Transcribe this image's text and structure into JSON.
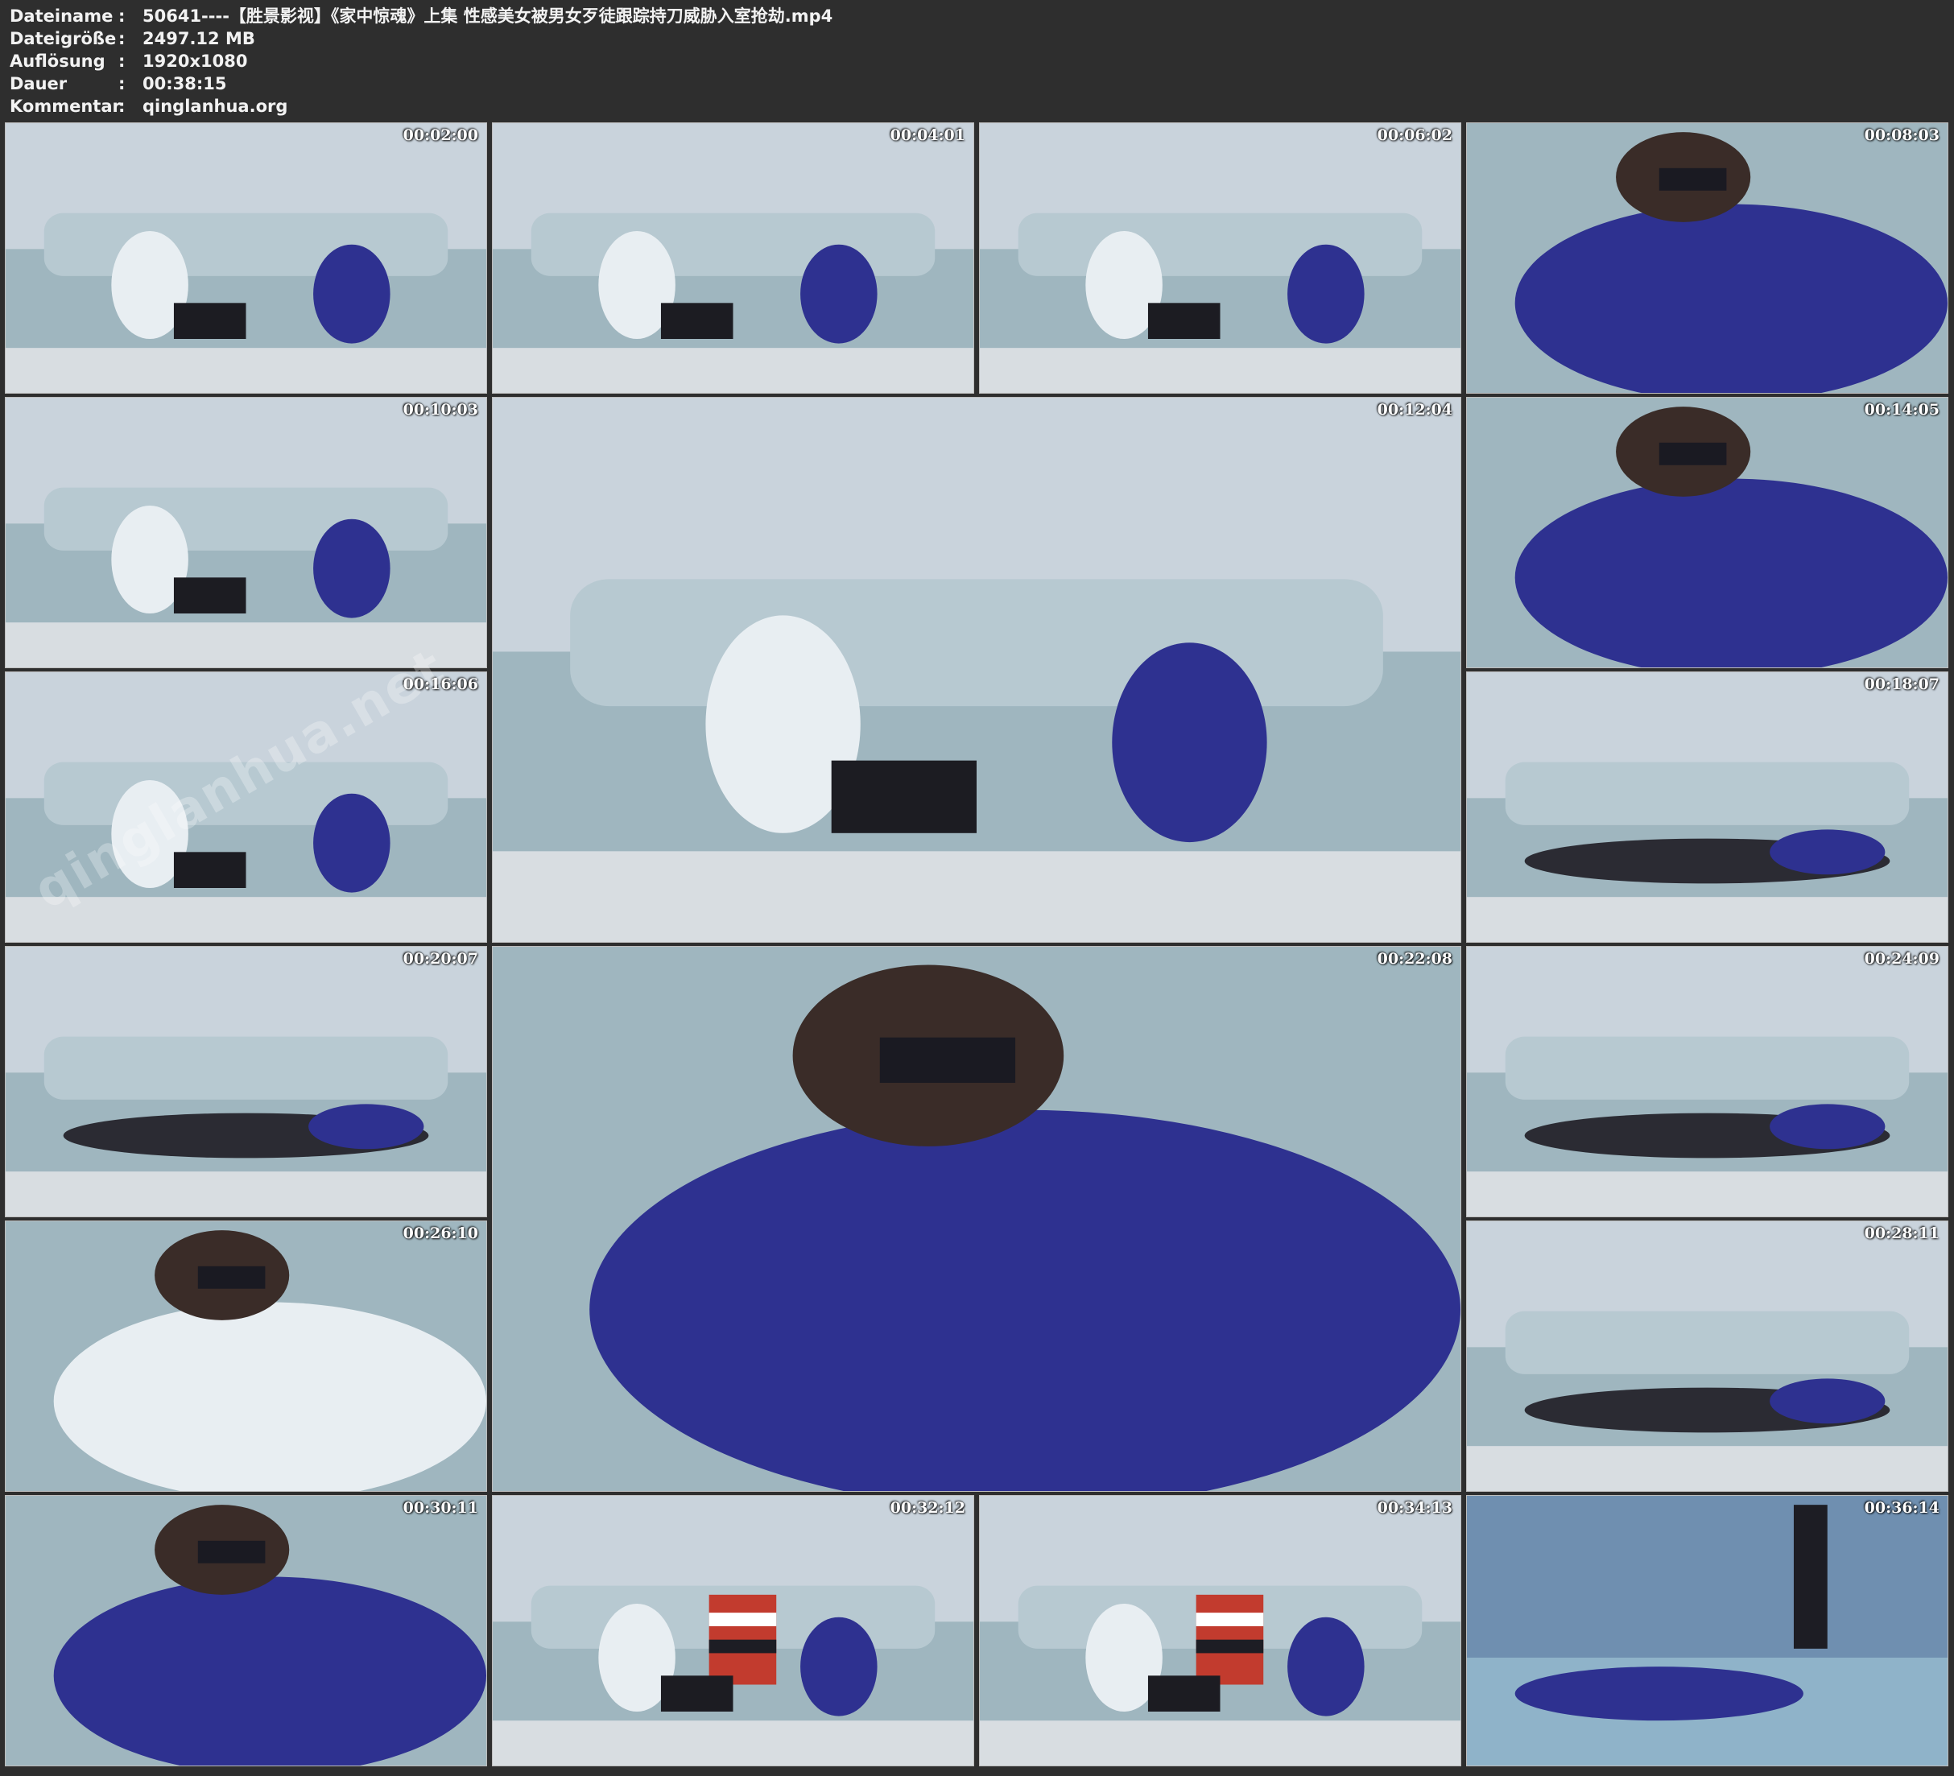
{
  "info": {
    "rows": [
      {
        "key": "Dateiname",
        "value": "50641----【胜景影视】《家中惊魂》上集 性感美女被男女歹徒跟踪持刀威胁入室抢劫.mp4"
      },
      {
        "key": "Dateigröße",
        "value": "2497.12 MB"
      },
      {
        "key": "Auflösung",
        "value": "1920x1080"
      },
      {
        "key": "Dauer",
        "value": "00:38:15"
      },
      {
        "key": "Kommentar",
        "value": "qinglanhua.org"
      }
    ],
    "separator": ":"
  },
  "watermark": "qinglanhua.net",
  "thumbnails": [
    {
      "timestamp": "00:02:00",
      "scene": "living-room-two-women-laptop"
    },
    {
      "timestamp": "00:04:01",
      "scene": "sofa-two-women-tied"
    },
    {
      "timestamp": "00:06:02",
      "scene": "sofa-two-women-tied"
    },
    {
      "timestamp": "00:08:03",
      "scene": "woman-sitting-sofa-closeup"
    },
    {
      "timestamp": "00:10:03",
      "scene": "sofa-two-women-tied"
    },
    {
      "timestamp": "00:12:04",
      "scene": "sofa-wide-large"
    },
    {
      "timestamp": "00:14:05",
      "scene": "closeup-blue-dress"
    },
    {
      "timestamp": "00:16:06",
      "scene": "sofa-two-women-tied"
    },
    {
      "timestamp": "00:18:07",
      "scene": "sofa-lying"
    },
    {
      "timestamp": "00:20:07",
      "scene": "sofa-lying"
    },
    {
      "timestamp": "00:22:08",
      "scene": "closeup-blue-dress-large"
    },
    {
      "timestamp": "00:24:09",
      "scene": "lying-pillows"
    },
    {
      "timestamp": "00:26:10",
      "scene": "closeup-face-white-shirt"
    },
    {
      "timestamp": "00:28:11",
      "scene": "sofa-lying"
    },
    {
      "timestamp": "00:30:11",
      "scene": "legs-closeup"
    },
    {
      "timestamp": "00:32:12",
      "scene": "man-striped-shirt"
    },
    {
      "timestamp": "00:34:13",
      "scene": "man-striped-shirt-closer"
    },
    {
      "timestamp": "00:36:14",
      "scene": "bedroom-standing-woman"
    }
  ],
  "colors": {
    "background": "#2e2e2e",
    "wall": "#c9d3dc",
    "sofa": "#9fb6bf",
    "dress": "#2e3190",
    "shirt": "#e8eef2"
  }
}
